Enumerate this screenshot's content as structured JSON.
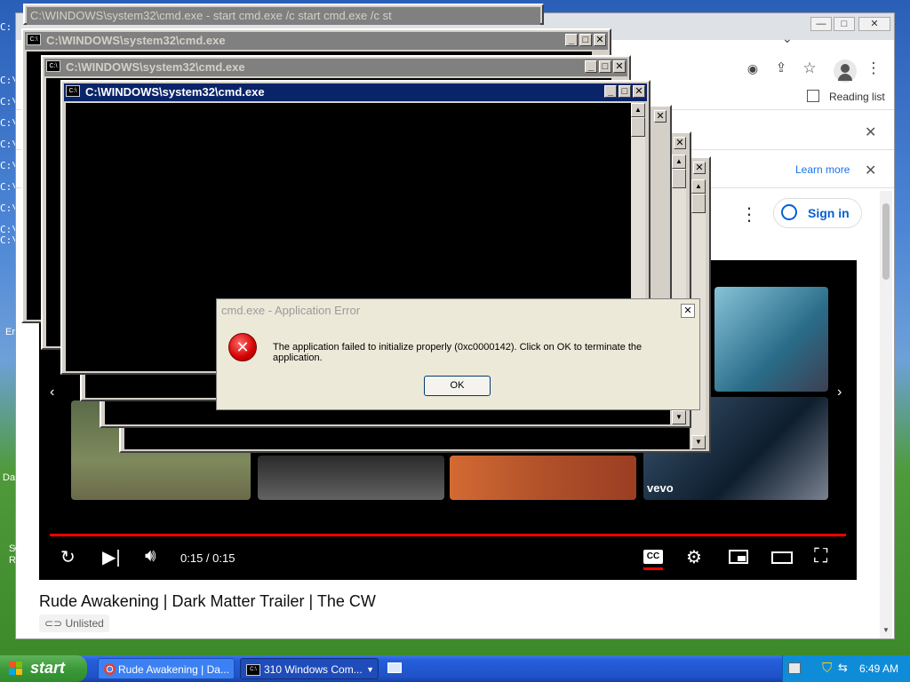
{
  "desktop": {
    "left_glyphs": [
      "C:",
      "C:\\",
      "C:\\",
      "C:\\",
      "C:\\",
      "C:\\",
      "C:\\",
      "C:\\",
      "C:\\",
      "C:\\"
    ],
    "label_er": "Er",
    "label_da": "Da",
    "label_s": "S",
    "label_r": "R"
  },
  "chrome": {
    "reading_list": "Reading list",
    "learn_more": "Learn more",
    "sign_in": "Sign in",
    "video": {
      "time": "0:15 / 0:15",
      "progress": 1.0,
      "accent_color": "#ff0000",
      "vevo": "vevo"
    },
    "video_title": "Rude Awakening | Dark Matter Trailer | The CW",
    "unlisted": "Unlisted"
  },
  "cmd_windows": {
    "top_title": "C:\\WINDOWS\\system32\\cmd.exe - start cmd.exe /c start cmd.exe /c st",
    "title": "C:\\WINDOWS\\system32\\cmd.exe",
    "top_partial": "C:\\WINDOWS\\system32\\cmd.exe"
  },
  "error_dialog": {
    "title": "cmd.exe - Application Error",
    "message": "The application failed to initialize properly (0xc0000142). Click on OK to terminate the application.",
    "ok_label": "OK"
  },
  "taskbar": {
    "start_label": "start",
    "tasks": [
      {
        "label": "Rude Awakening | Da..."
      },
      {
        "label": "310 Windows Com..."
      }
    ],
    "clock": "6:49 AM"
  }
}
